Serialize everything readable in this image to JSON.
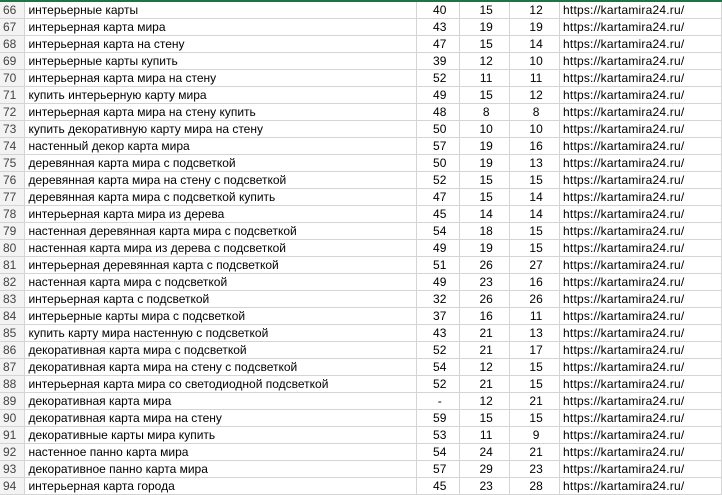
{
  "rows": [
    {
      "n": "66",
      "keyword": "интерьерные карты",
      "a": "40",
      "b": "15",
      "c": "12",
      "url": "https://kartamira24.ru/"
    },
    {
      "n": "67",
      "keyword": "интерьерная карта мира",
      "a": "43",
      "b": "19",
      "c": "19",
      "url": "https://kartamira24.ru/"
    },
    {
      "n": "68",
      "keyword": "интерьерная карта на стену",
      "a": "47",
      "b": "15",
      "c": "14",
      "url": "https://kartamira24.ru/"
    },
    {
      "n": "69",
      "keyword": "интерьерные карты купить",
      "a": "39",
      "b": "12",
      "c": "10",
      "url": "https://kartamira24.ru/"
    },
    {
      "n": "70",
      "keyword": "интерьерная карта мира на стену",
      "a": "52",
      "b": "11",
      "c": "11",
      "url": "https://kartamira24.ru/"
    },
    {
      "n": "71",
      "keyword": "купить интерьерную карту мира",
      "a": "49",
      "b": "15",
      "c": "12",
      "url": "https://kartamira24.ru/"
    },
    {
      "n": "72",
      "keyword": "интерьерная карта мира на стену купить",
      "a": "48",
      "b": "8",
      "c": "8",
      "url": "https://kartamira24.ru/"
    },
    {
      "n": "73",
      "keyword": "купить декоративную карту мира на стену",
      "a": "50",
      "b": "10",
      "c": "10",
      "url": "https://kartamira24.ru/"
    },
    {
      "n": "74",
      "keyword": "настенный декор карта мира",
      "a": "57",
      "b": "19",
      "c": "16",
      "url": "https://kartamira24.ru/"
    },
    {
      "n": "75",
      "keyword": "деревянная карта мира с подсветкой",
      "a": "50",
      "b": "19",
      "c": "13",
      "url": "https://kartamira24.ru/"
    },
    {
      "n": "76",
      "keyword": "деревянная карта мира на стену с подсветкой",
      "a": "52",
      "b": "15",
      "c": "15",
      "url": "https://kartamira24.ru/"
    },
    {
      "n": "77",
      "keyword": "деревянная карта мира с подсветкой купить",
      "a": "47",
      "b": "15",
      "c": "14",
      "url": "https://kartamira24.ru/"
    },
    {
      "n": "78",
      "keyword": "интерьерная карта мира из дерева",
      "a": "45",
      "b": "14",
      "c": "14",
      "url": "https://kartamira24.ru/"
    },
    {
      "n": "79",
      "keyword": "настенная деревянная карта мира с подсветкой",
      "a": "54",
      "b": "18",
      "c": "15",
      "url": "https://kartamira24.ru/"
    },
    {
      "n": "80",
      "keyword": "настенная карта мира из дерева с подсветкой",
      "a": "49",
      "b": "19",
      "c": "15",
      "url": "https://kartamira24.ru/"
    },
    {
      "n": "81",
      "keyword": "интерьерная деревянная карта с подсветкой",
      "a": "51",
      "b": "26",
      "c": "27",
      "url": "https://kartamira24.ru/"
    },
    {
      "n": "82",
      "keyword": "настенная карта мира с подсветкой",
      "a": "49",
      "b": "23",
      "c": "16",
      "url": "https://kartamira24.ru/"
    },
    {
      "n": "83",
      "keyword": "интерьерная карта с подсветкой",
      "a": "32",
      "b": "26",
      "c": "26",
      "url": "https://kartamira24.ru/"
    },
    {
      "n": "84",
      "keyword": "интерьерные карты мира с подсветкой",
      "a": "37",
      "b": "16",
      "c": "11",
      "url": "https://kartamira24.ru/"
    },
    {
      "n": "85",
      "keyword": "купить карту мира настенную с подсветкой",
      "a": "43",
      "b": "21",
      "c": "13",
      "url": "https://kartamira24.ru/"
    },
    {
      "n": "86",
      "keyword": "декоративная карта мира с подсветкой",
      "a": "52",
      "b": "21",
      "c": "17",
      "url": "https://kartamira24.ru/"
    },
    {
      "n": "87",
      "keyword": "декоративная карта мира на стену с подсветкой",
      "a": "54",
      "b": "12",
      "c": "15",
      "url": "https://kartamira24.ru/"
    },
    {
      "n": "88",
      "keyword": "интерьерная карта мира со светодиодной подсветкой",
      "a": "52",
      "b": "21",
      "c": "15",
      "url": "https://kartamira24.ru/"
    },
    {
      "n": "89",
      "keyword": "декоративная карта мира",
      "a": "-",
      "b": "12",
      "c": "21",
      "url": "https://kartamira24.ru/"
    },
    {
      "n": "90",
      "keyword": "декоративная карта мира на стену",
      "a": "59",
      "b": "15",
      "c": "15",
      "url": "https://kartamira24.ru/"
    },
    {
      "n": "91",
      "keyword": "декоративные карты мира купить",
      "a": "53",
      "b": "11",
      "c": "9",
      "url": "https://kartamira24.ru/"
    },
    {
      "n": "92",
      "keyword": "настенное панно карта мира",
      "a": "54",
      "b": "24",
      "c": "21",
      "url": "https://kartamira24.ru/"
    },
    {
      "n": "93",
      "keyword": "декоративное панно карта мира",
      "a": "57",
      "b": "29",
      "c": "23",
      "url": "https://kartamira24.ru/"
    },
    {
      "n": "94",
      "keyword": "интерьерная карта города",
      "a": "45",
      "b": "23",
      "c": "28",
      "url": "https://kartamira24.ru/"
    }
  ],
  "colors": {
    "gridline": "#d4d4d4",
    "row_header_bg": "#f3f3f3",
    "accent": "#217346"
  }
}
